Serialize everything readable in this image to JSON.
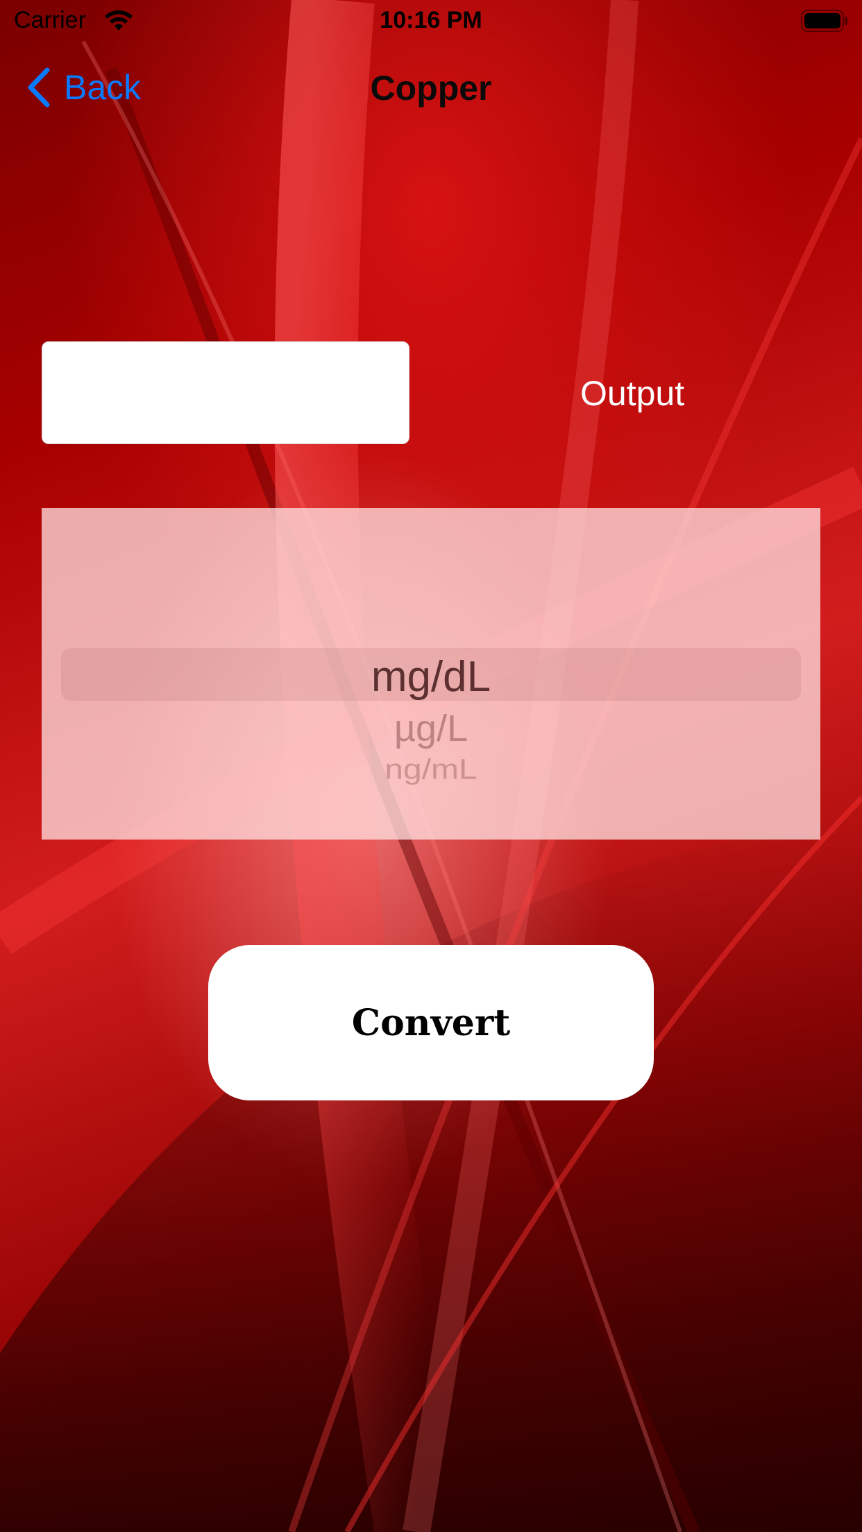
{
  "status_bar": {
    "carrier": "Carrier",
    "time": "10:16 PM",
    "icons": [
      "wifi-icon",
      "battery-icon"
    ]
  },
  "nav": {
    "back_label": "Back",
    "back_icon": "chevron-left-icon",
    "title": "Copper",
    "accent_color": "#0a7aff"
  },
  "converter": {
    "input": {
      "value": "",
      "placeholder": ""
    },
    "output_label": "Output",
    "units": {
      "selected": "mg/dL",
      "options": [
        "mg/dL",
        "µg/L",
        "ng/mL"
      ]
    },
    "convert_label": "Convert"
  },
  "theme": {
    "background": "#b30000",
    "button_background": "#ffffff"
  }
}
